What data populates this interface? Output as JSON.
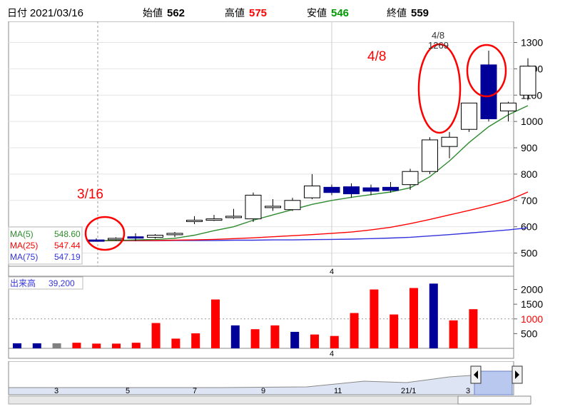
{
  "header": {
    "date_label": "日付",
    "date_value": "2021/03/16",
    "open_label": "始値",
    "open_value": "562",
    "high_label": "高値",
    "high_value": "575",
    "low_label": "安値",
    "low_value": "546",
    "close_label": "終値",
    "close_value": "559"
  },
  "colors": {
    "up": "#ffffff",
    "down": "#000099",
    "ma5": "#2e8b2e",
    "ma25": "#ff0000",
    "ma75": "#3333dd",
    "annotation": "#ff0000",
    "vol_up": "#ff0000",
    "vol_down": "#000099",
    "vol_flat": "#808080",
    "green_value": "#009900"
  },
  "chart_data": {
    "type": "candlestick",
    "ylim": [
      450,
      1380
    ],
    "y_ticks": [
      "500",
      "600",
      "700",
      "800",
      "900",
      "1000",
      "1100",
      "1200",
      "1300"
    ],
    "x_marker_label": "4",
    "candles": [
      {
        "o": 550,
        "h": 556,
        "l": 545,
        "c": 548
      },
      {
        "o": 552,
        "h": 560,
        "l": 548,
        "c": 556
      },
      {
        "o": 562,
        "h": 575,
        "l": 546,
        "c": 559
      },
      {
        "o": 560,
        "h": 572,
        "l": 555,
        "c": 568
      },
      {
        "o": 572,
        "h": 580,
        "l": 560,
        "c": 575
      },
      {
        "o": 625,
        "h": 640,
        "l": 610,
        "c": 625
      },
      {
        "o": 628,
        "h": 645,
        "l": 622,
        "c": 630
      },
      {
        "o": 640,
        "h": 668,
        "l": 630,
        "c": 640
      },
      {
        "o": 630,
        "h": 730,
        "l": 618,
        "c": 720
      },
      {
        "o": 678,
        "h": 705,
        "l": 660,
        "c": 678
      },
      {
        "o": 665,
        "h": 710,
        "l": 660,
        "c": 700
      },
      {
        "o": 710,
        "h": 800,
        "l": 705,
        "c": 755
      },
      {
        "o": 750,
        "h": 760,
        "l": 720,
        "c": 730
      },
      {
        "o": 752,
        "h": 765,
        "l": 710,
        "c": 725
      },
      {
        "o": 748,
        "h": 760,
        "l": 720,
        "c": 735
      },
      {
        "o": 750,
        "h": 770,
        "l": 730,
        "c": 738
      },
      {
        "o": 760,
        "h": 820,
        "l": 740,
        "c": 810
      },
      {
        "o": 810,
        "h": 940,
        "l": 800,
        "c": 930
      },
      {
        "o": 905,
        "h": 960,
        "l": 860,
        "c": 940
      },
      {
        "o": 970,
        "h": 1070,
        "l": 960,
        "c": 1070
      },
      {
        "o": 1215,
        "h": 1269,
        "l": 1000,
        "c": 1010
      },
      {
        "o": 1040,
        "h": 1075,
        "l": 1000,
        "c": 1070
      },
      {
        "o": 1100,
        "h": 1240,
        "l": 1080,
        "c": 1210
      }
    ],
    "ma5": [
      548,
      548,
      550,
      552,
      556,
      568,
      585,
      600,
      625,
      645,
      665,
      685,
      700,
      712,
      722,
      732,
      748,
      790,
      850,
      920,
      980,
      1025,
      1060
    ],
    "ma25": [
      547,
      547,
      548,
      548,
      549,
      550,
      552,
      555,
      558,
      562,
      566,
      570,
      575,
      580,
      588,
      598,
      612,
      628,
      645,
      662,
      680,
      700,
      732
    ],
    "ma75": [
      547,
      547,
      547,
      547,
      548,
      548,
      548,
      549,
      549,
      550,
      550,
      551,
      552,
      553,
      555,
      557,
      560,
      565,
      570,
      576,
      582,
      588,
      596
    ],
    "ma_legend": [
      {
        "label": "MA(5)",
        "value": "548.60"
      },
      {
        "label": "MA(25)",
        "value": "547.44"
      },
      {
        "label": "MA(75)",
        "value": "547.19"
      }
    ],
    "annotations": [
      {
        "text": "3/16"
      },
      {
        "text": "4/8"
      },
      {
        "text": "4/8"
      },
      {
        "text": "1269"
      }
    ],
    "volume": {
      "label": "出来高",
      "value": "39,200",
      "ylim": [
        0,
        2450
      ],
      "y_ticks": [
        "500",
        "1000",
        "1500",
        "2000"
      ],
      "ref_label": "1000",
      "bars": [
        {
          "v": 170,
          "c": "down"
        },
        {
          "v": 170,
          "c": "down"
        },
        {
          "v": 170,
          "c": "flat"
        },
        {
          "v": 190,
          "c": "up"
        },
        {
          "v": 160,
          "c": "up"
        },
        {
          "v": 160,
          "c": "up"
        },
        {
          "v": 190,
          "c": "up"
        },
        {
          "v": 860,
          "c": "up"
        },
        {
          "v": 330,
          "c": "up"
        },
        {
          "v": 510,
          "c": "up"
        },
        {
          "v": 1660,
          "c": "up"
        },
        {
          "v": 780,
          "c": "down"
        },
        {
          "v": 650,
          "c": "up"
        },
        {
          "v": 780,
          "c": "up"
        },
        {
          "v": 560,
          "c": "down"
        },
        {
          "v": 470,
          "c": "up"
        },
        {
          "v": 420,
          "c": "up"
        },
        {
          "v": 1200,
          "c": "up"
        },
        {
          "v": 2000,
          "c": "up"
        },
        {
          "v": 1150,
          "c": "up"
        },
        {
          "v": 2050,
          "c": "up"
        },
        {
          "v": 2200,
          "c": "down"
        },
        {
          "v": 950,
          "c": "up"
        },
        {
          "v": 1330,
          "c": "up"
        }
      ]
    },
    "navigator": {
      "labels": [
        "3",
        "5",
        "7",
        "9",
        "11",
        "21/1",
        "3"
      ]
    }
  }
}
